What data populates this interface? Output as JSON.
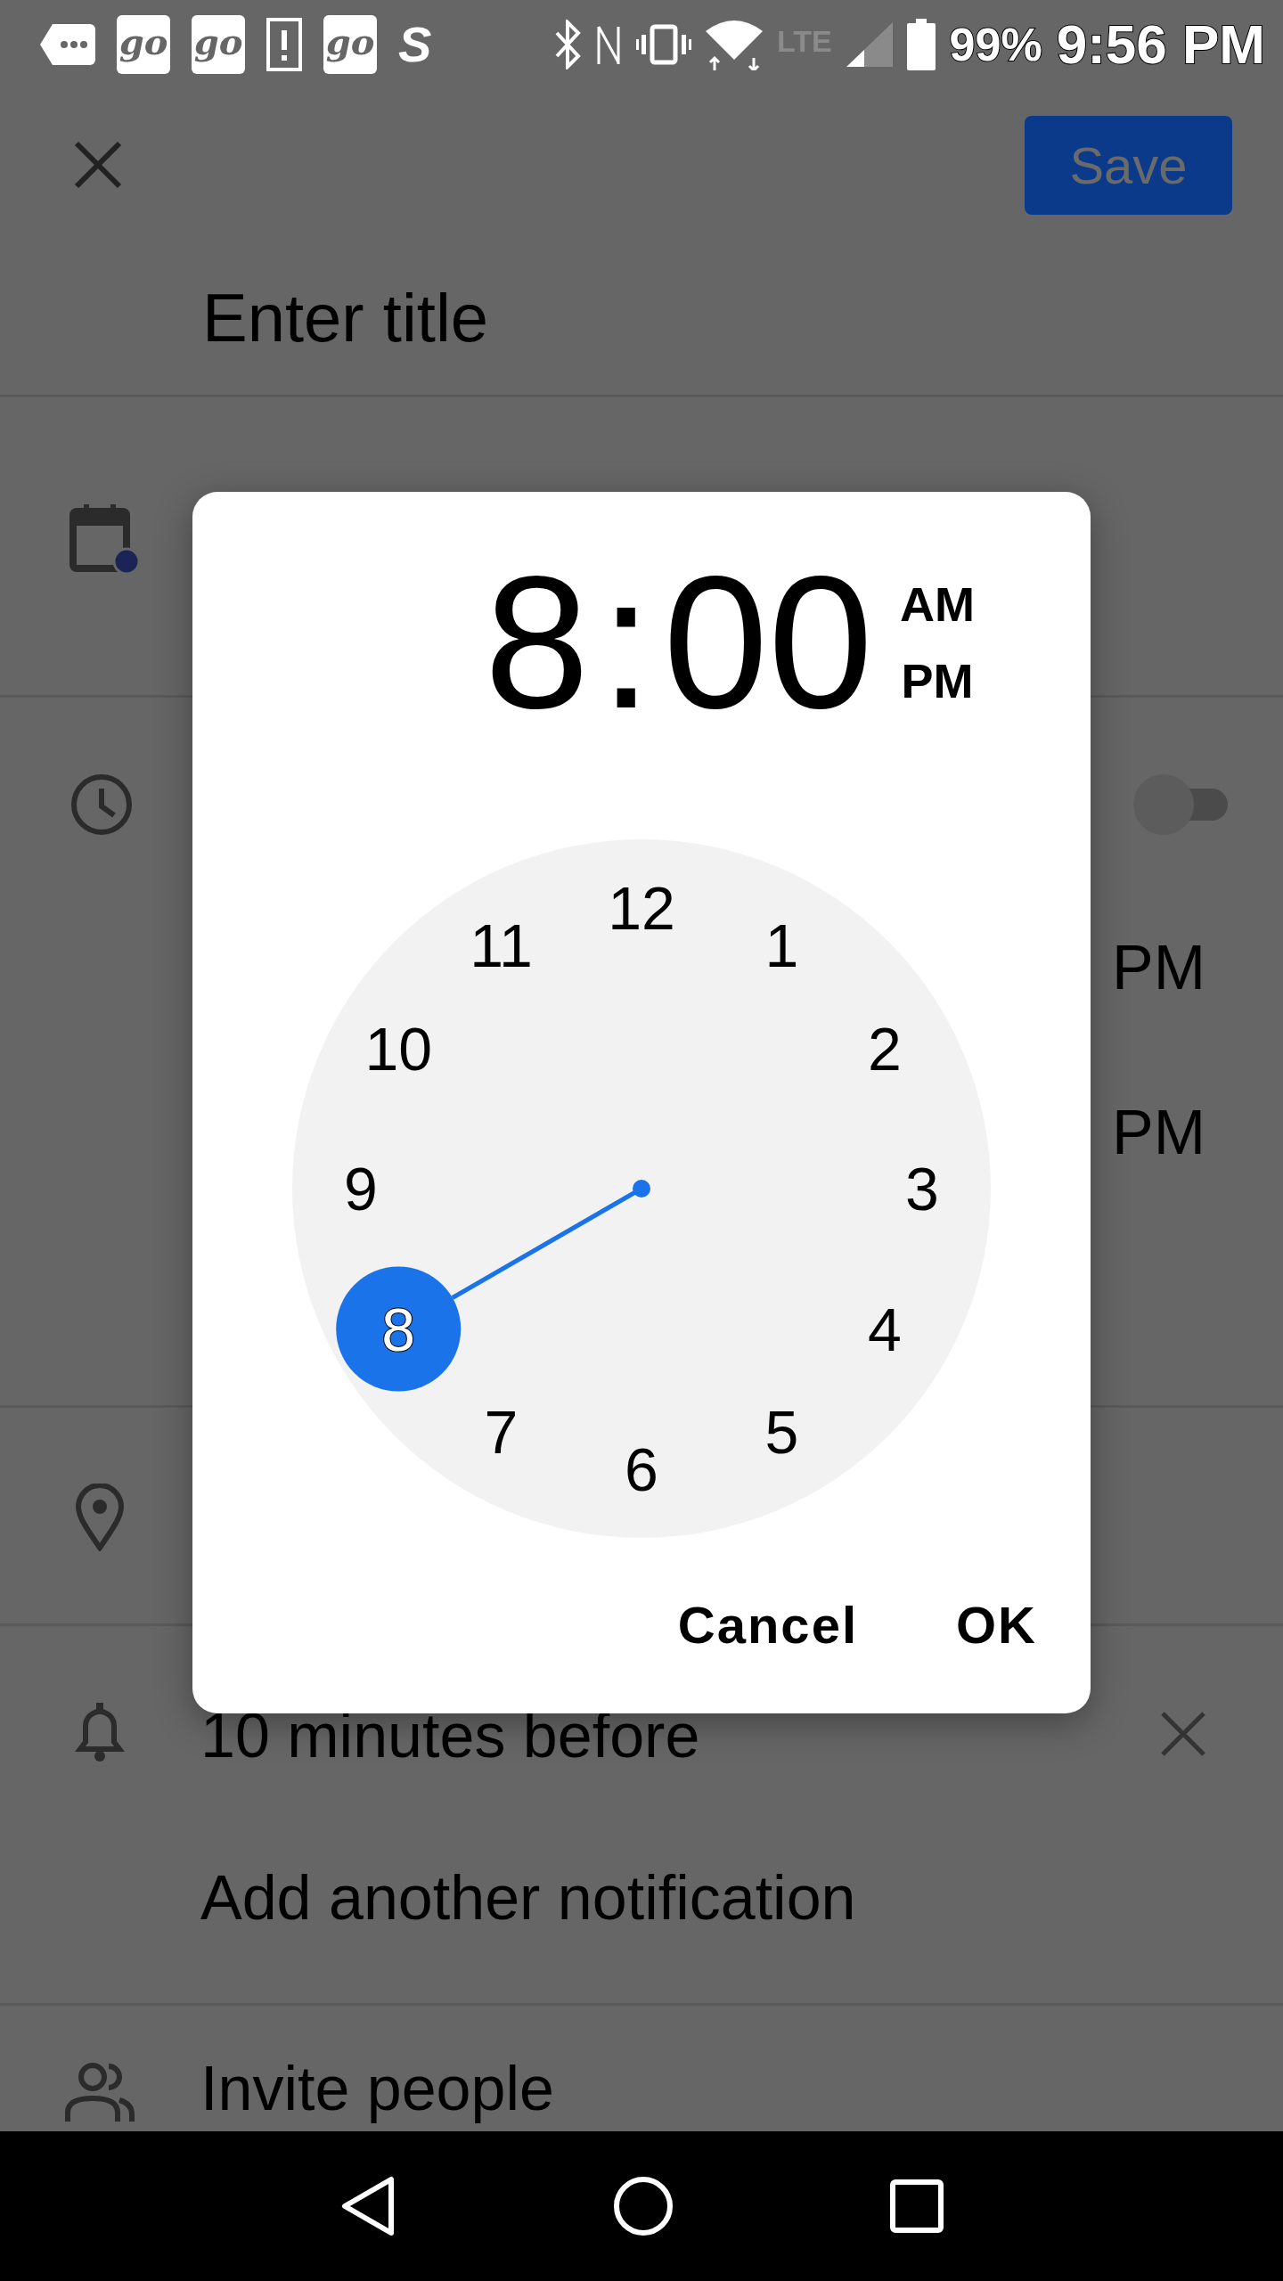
{
  "status_bar": {
    "notifications": [
      {
        "kind": "chat"
      },
      {
        "kind": "app",
        "label": "go"
      },
      {
        "kind": "app",
        "label": "go"
      },
      {
        "kind": "alert"
      },
      {
        "kind": "app",
        "label": "go"
      },
      {
        "kind": "letter",
        "label": "S"
      }
    ],
    "network": "LTE",
    "battery": "99%",
    "time": "9:56 PM"
  },
  "app_bar": {
    "save": "Save"
  },
  "title_field": {
    "placeholder": "Enter title"
  },
  "all_day_toggle": {
    "on": false
  },
  "time_rows": [
    {
      "end": "PM"
    },
    {
      "end": "PM"
    }
  ],
  "notification": {
    "text": "10 minutes before"
  },
  "add_notification": "Add another notification",
  "invite": "Invite people",
  "dialog": {
    "hour": "8",
    "separator": ":",
    "minutes": "00",
    "am": "AM",
    "pm": "PM",
    "dial": [
      {
        "label": "12",
        "selected": false
      },
      {
        "label": "1",
        "selected": false
      },
      {
        "label": "2",
        "selected": false
      },
      {
        "label": "3",
        "selected": false
      },
      {
        "label": "4",
        "selected": false
      },
      {
        "label": "5",
        "selected": false
      },
      {
        "label": "6",
        "selected": false
      },
      {
        "label": "7",
        "selected": false
      },
      {
        "label": "8",
        "selected": true
      },
      {
        "label": "9",
        "selected": false
      },
      {
        "label": "10",
        "selected": false
      },
      {
        "label": "11",
        "selected": false
      }
    ],
    "buttons": [
      "Cancel",
      "OK"
    ]
  }
}
